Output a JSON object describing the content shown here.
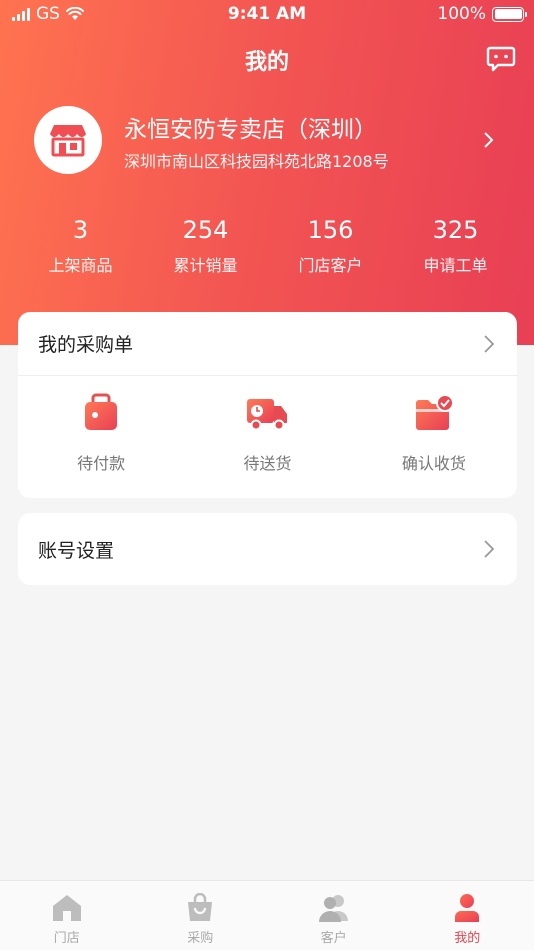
{
  "status_bar": {
    "carrier": "GS",
    "time": "9:41 AM",
    "battery": "100%"
  },
  "header": {
    "title": "我的"
  },
  "store": {
    "name": "永恒安防专卖店（深圳）",
    "address": "深圳市南山区科技园科苑北路1208号"
  },
  "stats": [
    {
      "value": "3",
      "label": "上架商品"
    },
    {
      "value": "254",
      "label": "累计销量"
    },
    {
      "value": "156",
      "label": "门店客户"
    },
    {
      "value": "325",
      "label": "申请工单"
    }
  ],
  "orders": {
    "title": "我的采购单",
    "items": [
      {
        "label": "待付款",
        "icon": "wallet-icon"
      },
      {
        "label": "待送货",
        "icon": "delivery-truck-icon"
      },
      {
        "label": "确认收货",
        "icon": "received-folder-icon"
      }
    ]
  },
  "settings": {
    "title": "账号设置"
  },
  "tabs": [
    {
      "label": "门店",
      "icon": "store-icon",
      "active": false
    },
    {
      "label": "采购",
      "icon": "shopping-bag-icon",
      "active": false
    },
    {
      "label": "客户",
      "icon": "customers-icon",
      "active": false
    },
    {
      "label": "我的",
      "icon": "profile-icon",
      "active": true
    }
  ],
  "colors": {
    "accent": "#e84750",
    "gradient_start": "#ff7350",
    "gradient_end": "#e83f55"
  }
}
